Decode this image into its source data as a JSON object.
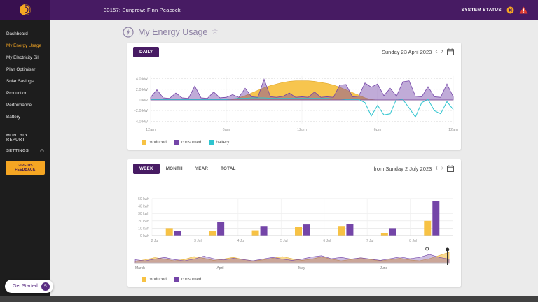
{
  "topbar": {
    "title": "33157: Sungrow: Finn Peacock",
    "system_status_label": "SYSTEM STATUS"
  },
  "sidebar": {
    "items": [
      {
        "label": "Dashboard",
        "active": false
      },
      {
        "label": "My Energy Usage",
        "active": true
      },
      {
        "label": "My Electricity Bill",
        "active": false
      },
      {
        "label": "Plan Optimiser",
        "active": false
      },
      {
        "label": "Solar Savings",
        "active": false
      },
      {
        "label": "Production",
        "active": false
      },
      {
        "label": "Performance",
        "active": false
      },
      {
        "label": "Battery",
        "active": false
      }
    ],
    "monthly_report_label": "MONTHLY REPORT",
    "settings_label": "SETTINGS",
    "feedback_button": "GIVE US FEEDBACK",
    "get_started_label": "Get Started",
    "get_started_badge": "5"
  },
  "page": {
    "title": "My Energy Usage"
  },
  "icons": {
    "prev": "‹",
    "next": "›",
    "star": "☆"
  },
  "daily_card": {
    "daily_button": "DAILY",
    "date_label": "Sunday 23 April 2023",
    "legend": [
      "produced",
      "consumed",
      "battery"
    ]
  },
  "weekly_card": {
    "tabs": [
      "WEEK",
      "MONTH",
      "YEAR",
      "TOTAL"
    ],
    "active_tab": "WEEK",
    "date_label": "from Sunday 2 July 2023",
    "legend": [
      "produced",
      "consumed"
    ]
  },
  "colors": {
    "purple_dark": "#471b63",
    "purple": "#7445a8",
    "yellow": "#f7c244",
    "yellow_dark": "#e0a92e",
    "cyan": "#2ec4cf",
    "orange": "#f5a623",
    "red": "#e03c31"
  },
  "chart_data": [
    {
      "id": "daily-power",
      "type": "area",
      "title": "Daily power flow (Sunday 23 April 2023)",
      "x_unit": "time of day, half-hour steps from 12am to 12am",
      "x_ticks": [
        {
          "pos": 0,
          "label": "12am"
        },
        {
          "pos": 0.25,
          "label": "6am"
        },
        {
          "pos": 0.5,
          "label": "12pm"
        },
        {
          "pos": 0.75,
          "label": "6pm"
        },
        {
          "pos": 1,
          "label": "12am"
        }
      ],
      "y_ticks": [
        {
          "v": 4,
          "label": "4.0 kW"
        },
        {
          "v": 2,
          "label": "2.0 kW"
        },
        {
          "v": 0,
          "label": "0 kW"
        },
        {
          "v": -2,
          "label": "-2.0 kW"
        },
        {
          "v": -4,
          "label": "-4.0 kW"
        }
      ],
      "ylim": [
        -4.5,
        4.5
      ],
      "legend_position": "bottom-left",
      "series": [
        {
          "name": "produced",
          "unit": "kW",
          "values": [
            0,
            0,
            0,
            0,
            0,
            0,
            0,
            0,
            0,
            0,
            0,
            0,
            0,
            0.1,
            0.4,
            0.8,
            1.3,
            1.8,
            2.3,
            2.7,
            3.0,
            3.3,
            3.5,
            3.6,
            3.6,
            3.6,
            3.5,
            3.3,
            3.1,
            2.8,
            2.4,
            1.9,
            1.4,
            0.9,
            0.4,
            0.1,
            0,
            0,
            0,
            0,
            0,
            0,
            0,
            0,
            0,
            0,
            0,
            0,
            0
          ]
        },
        {
          "name": "consumed",
          "unit": "kW",
          "values": [
            0.5,
            1.9,
            0.4,
            0.3,
            1.3,
            0.4,
            0.3,
            2.6,
            0.4,
            0.3,
            1.5,
            0.4,
            0.5,
            1.0,
            0.5,
            2.2,
            0.6,
            0.5,
            3.9,
            0.6,
            0.5,
            0.7,
            1.3,
            0.5,
            0.6,
            0.5,
            1.5,
            0.5,
            0.6,
            0.5,
            2.8,
            2.9,
            0.6,
            0.7,
            3.2,
            2.4,
            3.0,
            0.8,
            2.2,
            0.7,
            3.4,
            3.6,
            0.7,
            0.6,
            2.5,
            0.6,
            0.5,
            3.0,
            0.6
          ]
        },
        {
          "name": "battery",
          "unit": "kW",
          "values": [
            0.1,
            0.1,
            0.1,
            0.1,
            0.1,
            0.1,
            0.1,
            0.1,
            0.1,
            0.1,
            0.1,
            0.1,
            0.1,
            0.2,
            0.3,
            0.3,
            0.4,
            0.4,
            0.4,
            0.3,
            0.3,
            0.3,
            0.3,
            0.3,
            0.3,
            0.3,
            0.3,
            0.3,
            0.3,
            0.2,
            0.2,
            0.1,
            0.1,
            0.1,
            -0.5,
            -3.0,
            -1.0,
            -2.8,
            -2.6,
            0.2,
            0.1,
            -1.5,
            -3.2,
            -0.5,
            0.1,
            -2.0,
            -2.6,
            -0.3,
            -1.8
          ]
        }
      ]
    },
    {
      "id": "weekly-energy",
      "type": "bar",
      "title": "Weekly energy from Sunday 2 July 2023",
      "categories": [
        "2 Jul",
        "3 Jul",
        "4 Jul",
        "5 Jul",
        "6 Jul",
        "7 Jul",
        "8 Jul"
      ],
      "y_ticks": [
        {
          "v": 0,
          "label": "0 kwh"
        },
        {
          "v": 10,
          "label": "10 kwh"
        },
        {
          "v": 20,
          "label": "20 kwh"
        },
        {
          "v": 30,
          "label": "30 kwh"
        },
        {
          "v": 40,
          "label": "40 kwh"
        },
        {
          "v": 50,
          "label": "50 kwh"
        }
      ],
      "ylim": [
        0,
        50
      ],
      "legend_position": "bottom-left",
      "series": [
        {
          "name": "produced",
          "unit": "kWh",
          "values": [
            10,
            6,
            7,
            12,
            13,
            3,
            20
          ]
        },
        {
          "name": "consumed",
          "unit": "kWh",
          "values": [
            6,
            18,
            13,
            15,
            16,
            10,
            47
          ]
        }
      ]
    },
    {
      "id": "history-timeline",
      "type": "area",
      "title": "History scrubber March to July",
      "month_labels": [
        {
          "pos": 0,
          "label": "March"
        },
        {
          "pos": 0.26,
          "label": "April"
        },
        {
          "pos": 0.52,
          "label": "May"
        },
        {
          "pos": 0.78,
          "label": "June"
        }
      ],
      "ymax": 6,
      "produced": [
        0.8,
        1.5,
        2.5,
        1.8,
        1.0,
        1.6,
        3.0,
        2.2,
        1.2,
        1.8,
        2.6,
        1.6,
        1.0,
        1.4,
        2.2,
        3.0,
        2.0,
        1.2,
        1.8,
        2.8,
        1.8,
        1.0,
        1.6,
        2.4,
        1.6,
        1.0,
        1.5,
        2.2,
        1.4,
        1.0,
        2.0,
        3.5,
        5.0
      ],
      "consumed": [
        1.5,
        1.0,
        1.8,
        2.6,
        1.6,
        1.0,
        1.8,
        3.2,
        2.0,
        1.4,
        2.2,
        1.6,
        1.0,
        1.8,
        2.6,
        1.8,
        1.2,
        1.8,
        2.8,
        3.4,
        2.0,
        2.6,
        1.8,
        2.4,
        1.8,
        1.2,
        2.0,
        2.8,
        2.0,
        2.6,
        4.0,
        2.6,
        1.8
      ],
      "marker_pos": 0.93,
      "handle_pos": 0.995
    }
  ]
}
